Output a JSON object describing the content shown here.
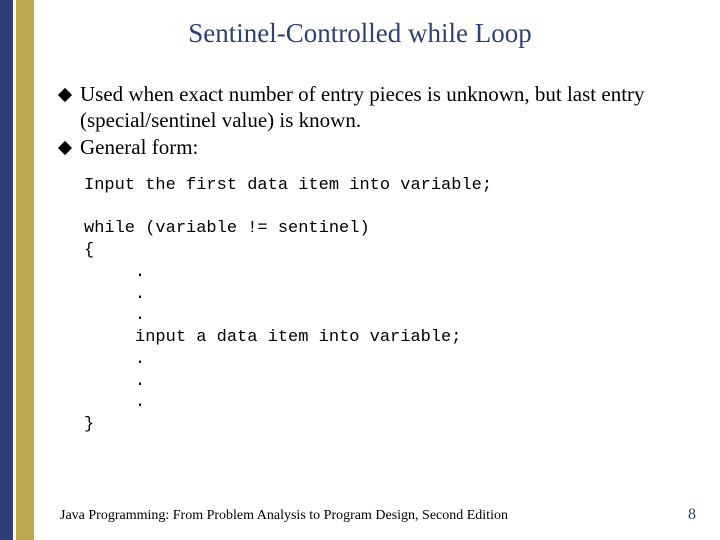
{
  "title": "Sentinel-Controlled while Loop",
  "bullets": [
    "Used when exact number of entry pieces is unknown, but last entry (special/sentinel value) is known.",
    "General form:"
  ],
  "code": "Input the first data item into variable;\n\nwhile (variable != sentinel)\n{\n     .\n     .\n     .\n     input a data item into variable;\n     .\n     .\n     .\n}",
  "footer": "Java Programming: From Problem Analysis to Program Design, Second Edition",
  "page_number": "8"
}
